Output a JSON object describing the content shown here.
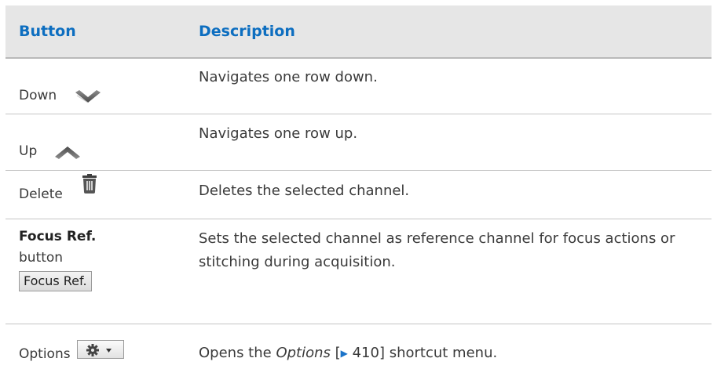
{
  "header": {
    "col1": "Button",
    "col2": "Description"
  },
  "rows": [
    {
      "label": "Down",
      "icon": "chevron-down-icon",
      "description": "Navigates one row down."
    },
    {
      "label": "Up",
      "icon": "chevron-up-icon",
      "description": "Navigates one row up."
    },
    {
      "label": "Delete",
      "icon": "trash-icon",
      "description": "Deletes the selected channel."
    },
    {
      "label": "Focus Ref.",
      "sublabel": "button",
      "button_label": "Focus Ref.",
      "description": "Sets the selected channel as reference channel for focus actions or stitching during acquisition."
    },
    {
      "label": "Options",
      "icon": "gear-dropdown-icon",
      "description_parts": {
        "before": "Opens the ",
        "link": "Options",
        "ref_open": " [",
        "ref_arrow": "▶",
        "ref_page": " 410",
        "ref_close": "]",
        "after": " shortcut menu."
      }
    }
  ],
  "colors": {
    "header_text": "#0d6ec0",
    "header_bg": "#e6e6e6",
    "xref_arrow": "#1a73c9"
  }
}
